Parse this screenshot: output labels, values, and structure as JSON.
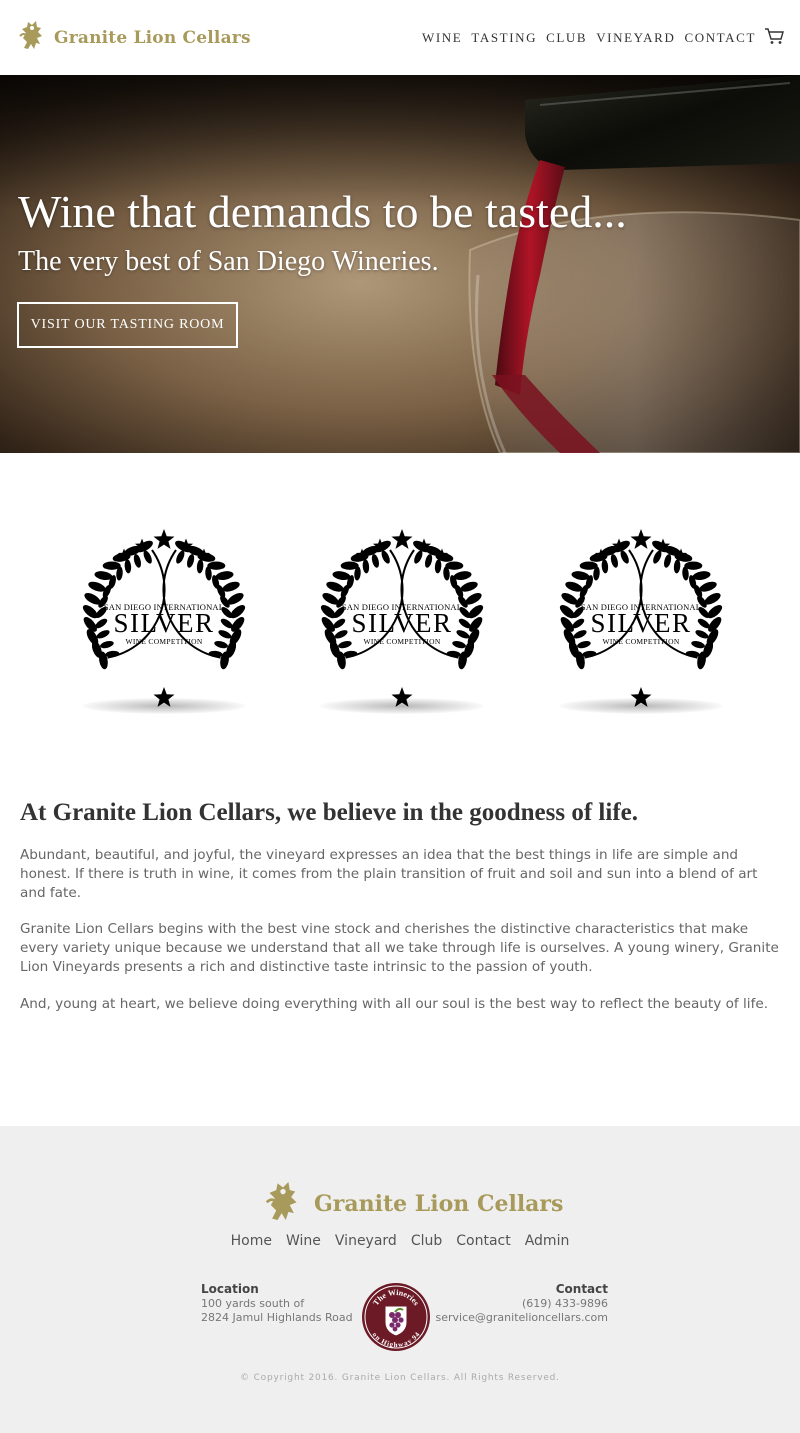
{
  "header": {
    "brand": "Granite Lion Cellars",
    "nav": [
      "WINE",
      "TASTING",
      "CLUB",
      "VINEYARD",
      "CONTACT"
    ],
    "cart_icon": "cart-icon"
  },
  "hero": {
    "title": "Wine that demands to be tasted...",
    "subtitle": "The very best of San Diego Wineries.",
    "button": "VISIT OUR TASTING ROOM"
  },
  "awards": [
    {
      "top": "SAN DIEGO INTERNATIONAL",
      "medal": "SILVER",
      "bottom": "WINE COMPETITION"
    },
    {
      "top": "SAN DIEGO INTERNATIONAL",
      "medal": "SILVER",
      "bottom": "WINE COMPETITION"
    },
    {
      "top": "SAN DIEGO INTERNATIONAL",
      "medal": "SILVER",
      "bottom": "WINE COMPETITION"
    }
  ],
  "about": {
    "heading": "At Granite Lion Cellars, we believe in the goodness of life.",
    "paragraphs": [
      "Abundant, beautiful, and joyful, the vineyard expresses an idea that the best things in life are simple and honest. If there is truth in wine, it comes from the plain transition of fruit and soil and sun into a blend of art and fate.",
      "Granite Lion Cellars begins with the best vine stock and cherishes the distinctive characteristics that make every variety unique because we understand that all we take through life is ourselves. A young winery, Granite Lion Vineyards presents a rich and distinctive taste intrinsic to the passion of youth.",
      "And, young at heart, we believe doing everything with all our soul is the best way to reflect the beauty of life."
    ]
  },
  "footer": {
    "brand": "Granite Lion Cellars",
    "links": [
      "Home",
      "Wine",
      "Vineyard",
      "Club",
      "Contact",
      "Admin"
    ],
    "location": {
      "heading": "Location",
      "line1": "100 yards south of",
      "line2": "2824 Jamul Highlands Road"
    },
    "badge": {
      "top": "The Wineries",
      "bottom": "on Highway 94"
    },
    "contact": {
      "heading": "Contact",
      "phone": "(619) 433-9896",
      "email": "service@granitelioncellars.com"
    },
    "copyright": "© Copyright 2016. Granite Lion Cellars. All Rights Reserved."
  },
  "colors": {
    "gold": "#a89a5a",
    "wine": "#6b1a26",
    "footer_bg": "#efefef"
  }
}
